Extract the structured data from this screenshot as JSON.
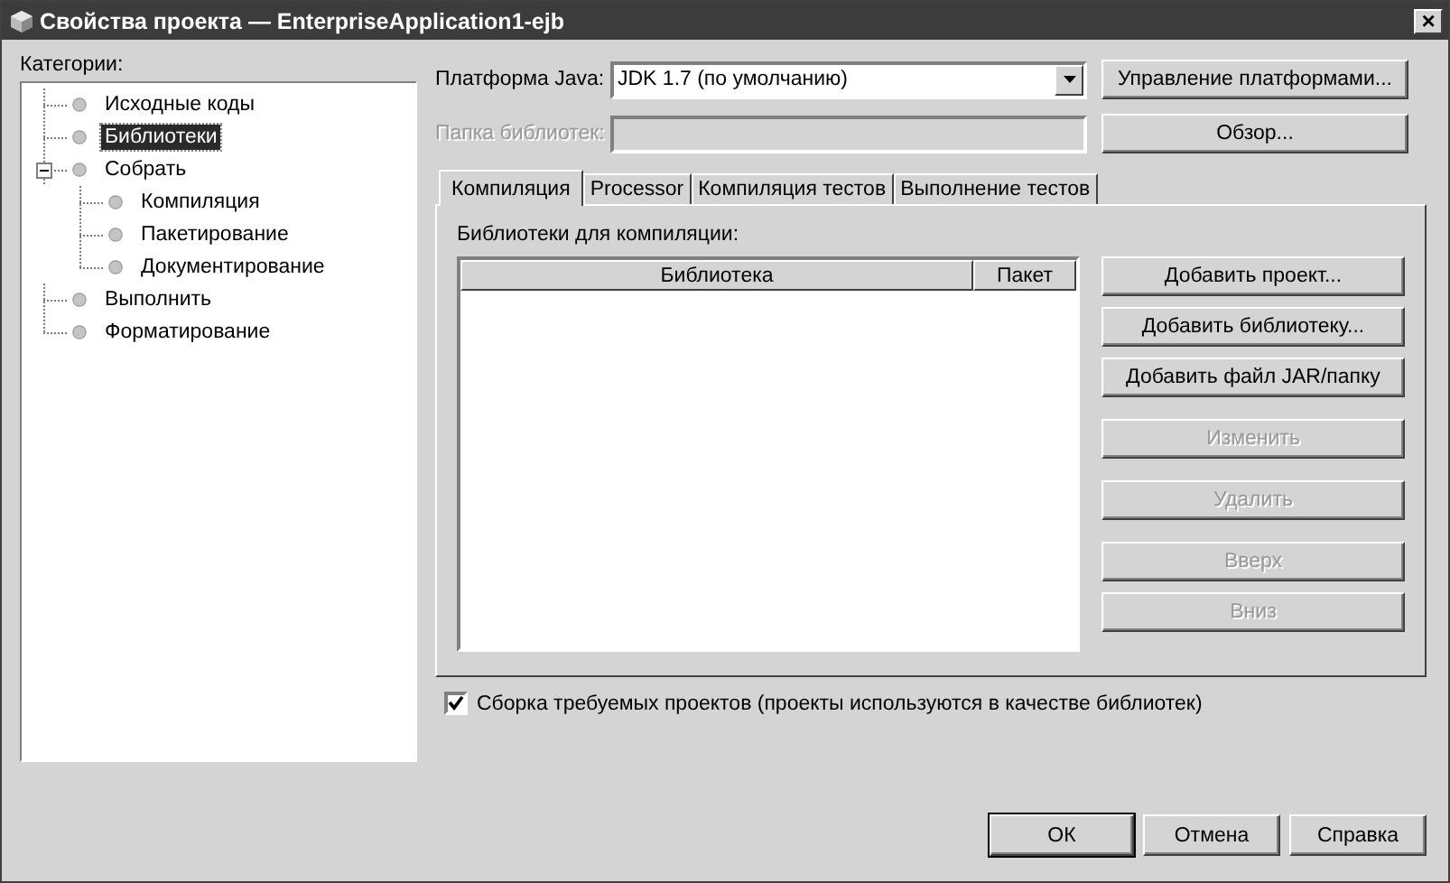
{
  "window": {
    "title": "Свойства проекта — EnterpriseApplication1-ejb",
    "close": "×"
  },
  "categories": {
    "label": "Категории:",
    "items": [
      {
        "label": "Исходные коды",
        "selected": false
      },
      {
        "label": "Библиотеки",
        "selected": true
      },
      {
        "label": "Собрать",
        "selected": false,
        "expanded": true,
        "children": [
          {
            "label": "Компиляция",
            "selected": false
          },
          {
            "label": "Пакетирование",
            "selected": false
          },
          {
            "label": "Документирование",
            "selected": false
          }
        ]
      },
      {
        "label": "Выполнить",
        "selected": false
      },
      {
        "label": "Форматирование",
        "selected": false
      }
    ]
  },
  "platform": {
    "label": "Платформа Java:",
    "value": "JDK 1.7 (по умолчанию)",
    "button": "Управление платформами..."
  },
  "library_folder": {
    "label": "Папка библиотек:",
    "disabled": true,
    "button": "Обзор..."
  },
  "tabs": [
    {
      "label": "Компиляция",
      "selected": true
    },
    {
      "label": "Processor",
      "selected": false
    },
    {
      "label": "Компиляция тестов",
      "selected": false
    },
    {
      "label": "Выполнение тестов",
      "selected": false
    }
  ],
  "libraries": {
    "label": "Библиотеки для компиляции:",
    "columns": [
      "Библиотека",
      "Пакет"
    ],
    "buttons": [
      {
        "label": "Добавить проект...",
        "disabled": false
      },
      {
        "label": "Добавить библиотеку...",
        "disabled": false
      },
      {
        "label": "Добавить файл JAR/папку",
        "disabled": false
      },
      {
        "label": "Изменить",
        "disabled": true
      },
      {
        "label": "Удалить",
        "disabled": true
      },
      {
        "label": "Вверх",
        "disabled": true
      },
      {
        "label": "Вниз",
        "disabled": true
      }
    ]
  },
  "build_required": {
    "label": "Сборка требуемых проектов (проекты используются в качестве библиотек)",
    "checked": true
  },
  "footer_buttons": [
    {
      "label": "ОК",
      "default": true
    },
    {
      "label": "Отмена",
      "default": false
    },
    {
      "label": "Справка",
      "default": false
    }
  ]
}
